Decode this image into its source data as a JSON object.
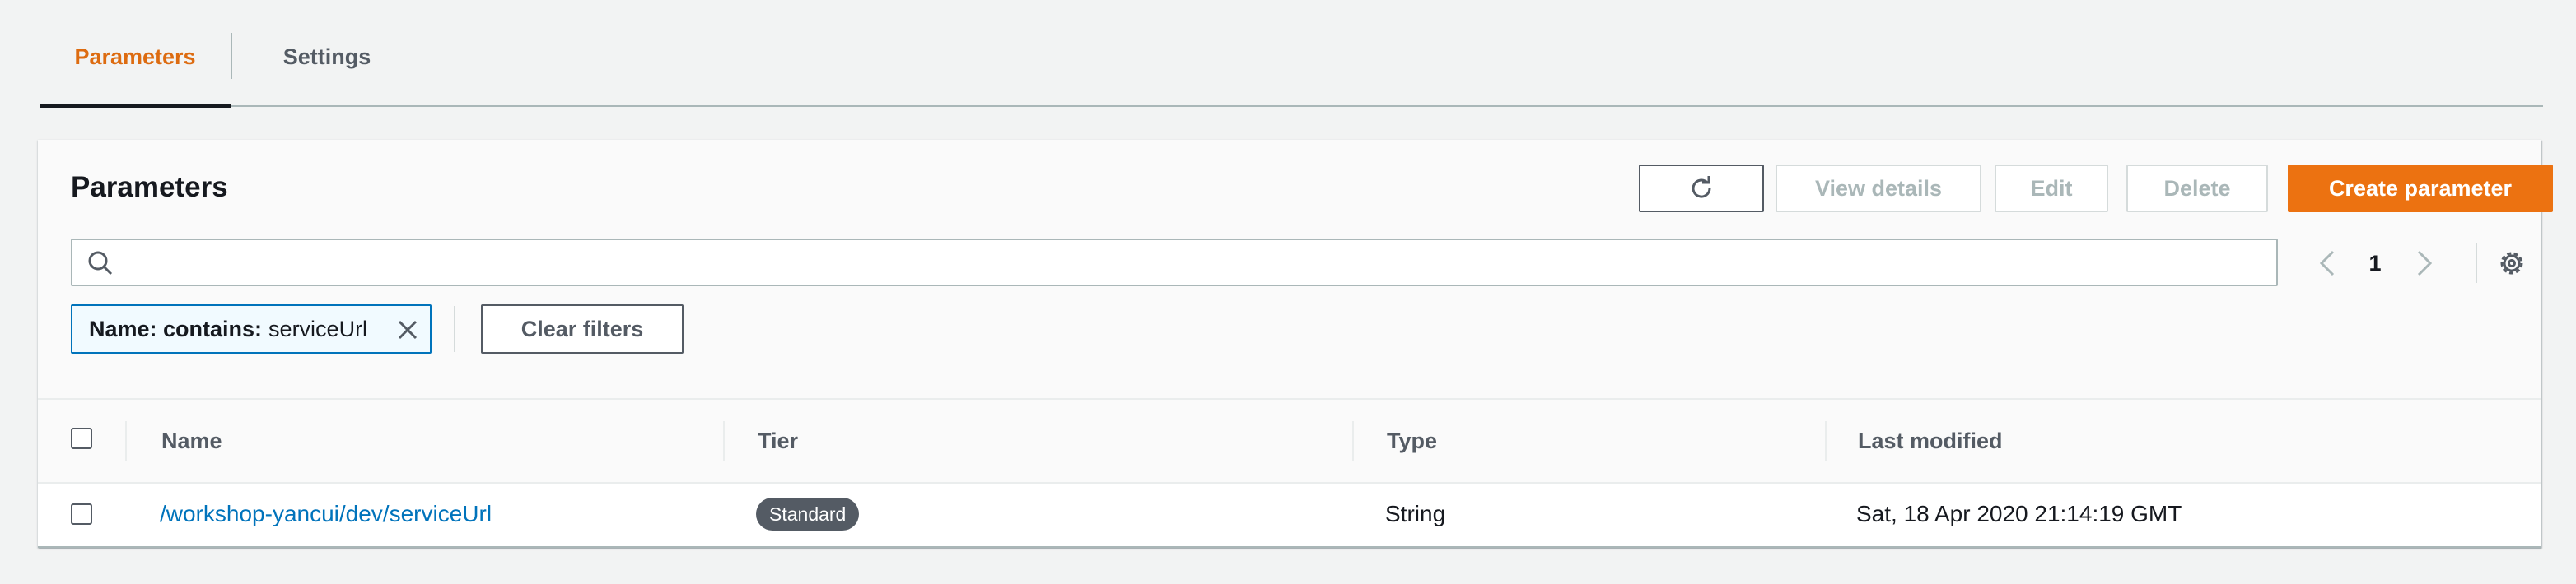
{
  "tabs": [
    {
      "label": "Parameters",
      "active": true
    },
    {
      "label": "Settings",
      "active": false
    }
  ],
  "panel": {
    "title": "Parameters",
    "actions": {
      "view_details": "View details",
      "edit": "Edit",
      "delete": "Delete",
      "create": "Create parameter"
    },
    "search": {
      "value": "",
      "placeholder": ""
    },
    "pagination": {
      "current_page": "1"
    },
    "filter_token": {
      "key": "Name: contains:",
      "value": "serviceUrl"
    },
    "clear_filters": "Clear filters"
  },
  "table": {
    "columns": [
      "Name",
      "Tier",
      "Type",
      "Last modified"
    ],
    "rows": [
      {
        "name": "/workshop-yancui/dev/serviceUrl",
        "tier": "Standard",
        "type": "String",
        "last_modified": "Sat, 18 Apr 2020 21:14:19 GMT"
      }
    ]
  },
  "icons": [
    "refresh-icon",
    "search-icon",
    "chevron-left-icon",
    "chevron-right-icon",
    "gear-icon",
    "close-icon"
  ],
  "colors": {
    "accent": "#ec7211",
    "active_tab": "#dd6b10",
    "link": "#0073bb",
    "badge_bg": "#545b64"
  }
}
